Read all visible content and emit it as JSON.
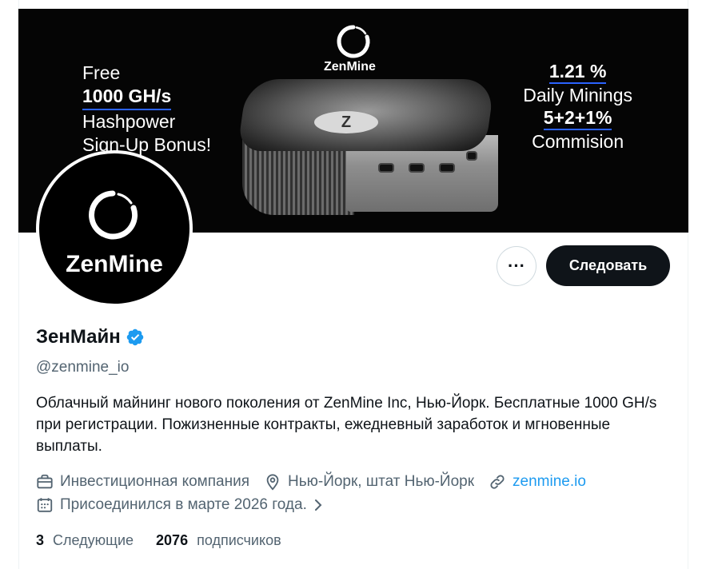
{
  "banner": {
    "brand": "ZenMine",
    "device_logo": "Z",
    "promo_left": {
      "line1": "Free",
      "line2": "1000 GH/s",
      "line3": "Hashpower",
      "line4": "Sign-Up Bonus!"
    },
    "promo_right": {
      "line1": "1.21 %",
      "line2": "Daily Minings",
      "line3": "5+2+1%",
      "line4": "Commision"
    }
  },
  "avatar": {
    "text": "ZenMine"
  },
  "actions": {
    "more_label": "···",
    "follow_label": "Следовать"
  },
  "profile": {
    "name": "ЗенМайн",
    "handle": "@zenmine_io",
    "bio": "Облачный майнинг нового поколения от ZenMine Inc, Нью-Йорк. Бесплатные 1000 GH/s при регистрации. Пожизненные контракты, ежедневный заработок и мгновенные выплаты.",
    "category": "Инвестиционная компания",
    "location": "Нью-Йорк, штат Нью-Йорк",
    "website": "zenmine.io",
    "joined": "Присоединился в марте 2026 года."
  },
  "stats": {
    "following_count": "3",
    "following_label": "Следующие",
    "followers_count": "2076",
    "followers_label": "подписчиков"
  },
  "colors": {
    "accent": "#1d9bf0",
    "button": "#0f1419",
    "muted": "#536471",
    "banner_underline": "#2b63ff"
  },
  "icons": [
    "briefcase-icon",
    "location-pin-icon",
    "link-icon",
    "calendar-icon",
    "chevron-right-icon",
    "verified-badge-icon",
    "more-icon"
  ]
}
